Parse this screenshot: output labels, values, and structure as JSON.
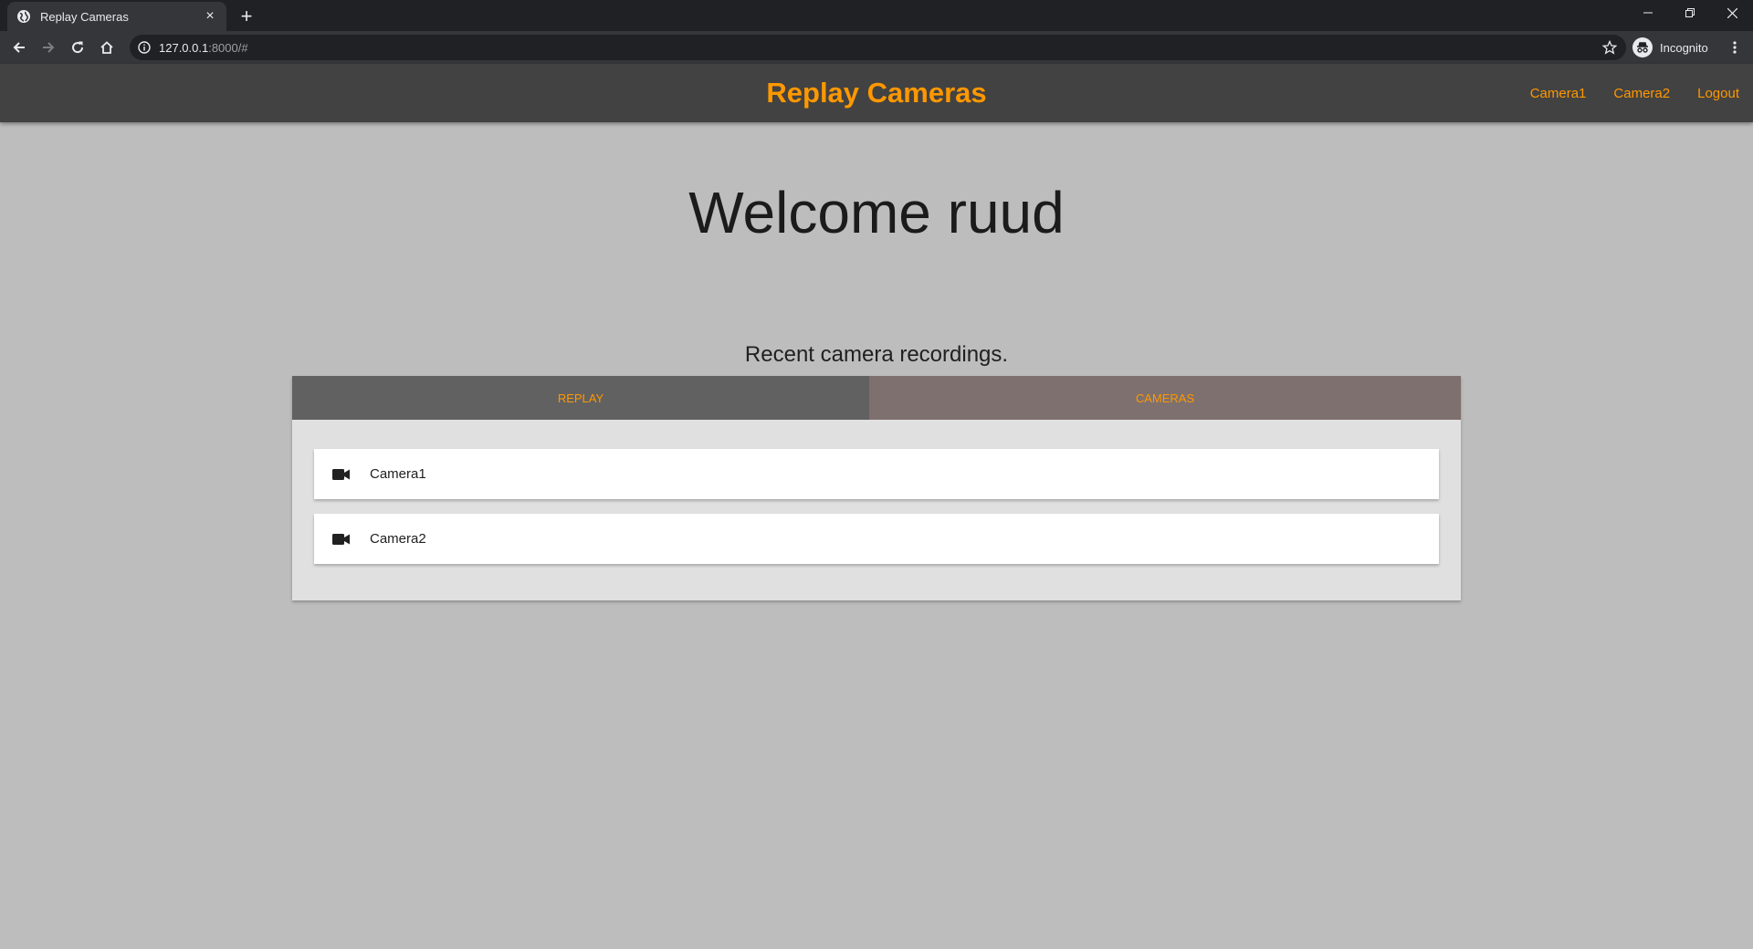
{
  "browser": {
    "tab_title": "Replay Cameras",
    "url_host": "127.0.0.1",
    "url_rest": ":8000/#",
    "profile_label": "Incognito"
  },
  "app": {
    "brand": "Replay Cameras",
    "nav": [
      {
        "label": "Camera1"
      },
      {
        "label": "Camera2"
      },
      {
        "label": "Logout"
      }
    ],
    "accent_color": "#ff9800"
  },
  "main": {
    "welcome": "Welcome ruud",
    "subtitle": "Recent camera recordings.",
    "tabs": [
      {
        "label": "REPLAY"
      },
      {
        "label": "CAMERAS"
      }
    ],
    "items": [
      {
        "label": "Camera1",
        "icon": "videocam-icon"
      },
      {
        "label": "Camera2",
        "icon": "videocam-icon"
      }
    ]
  }
}
